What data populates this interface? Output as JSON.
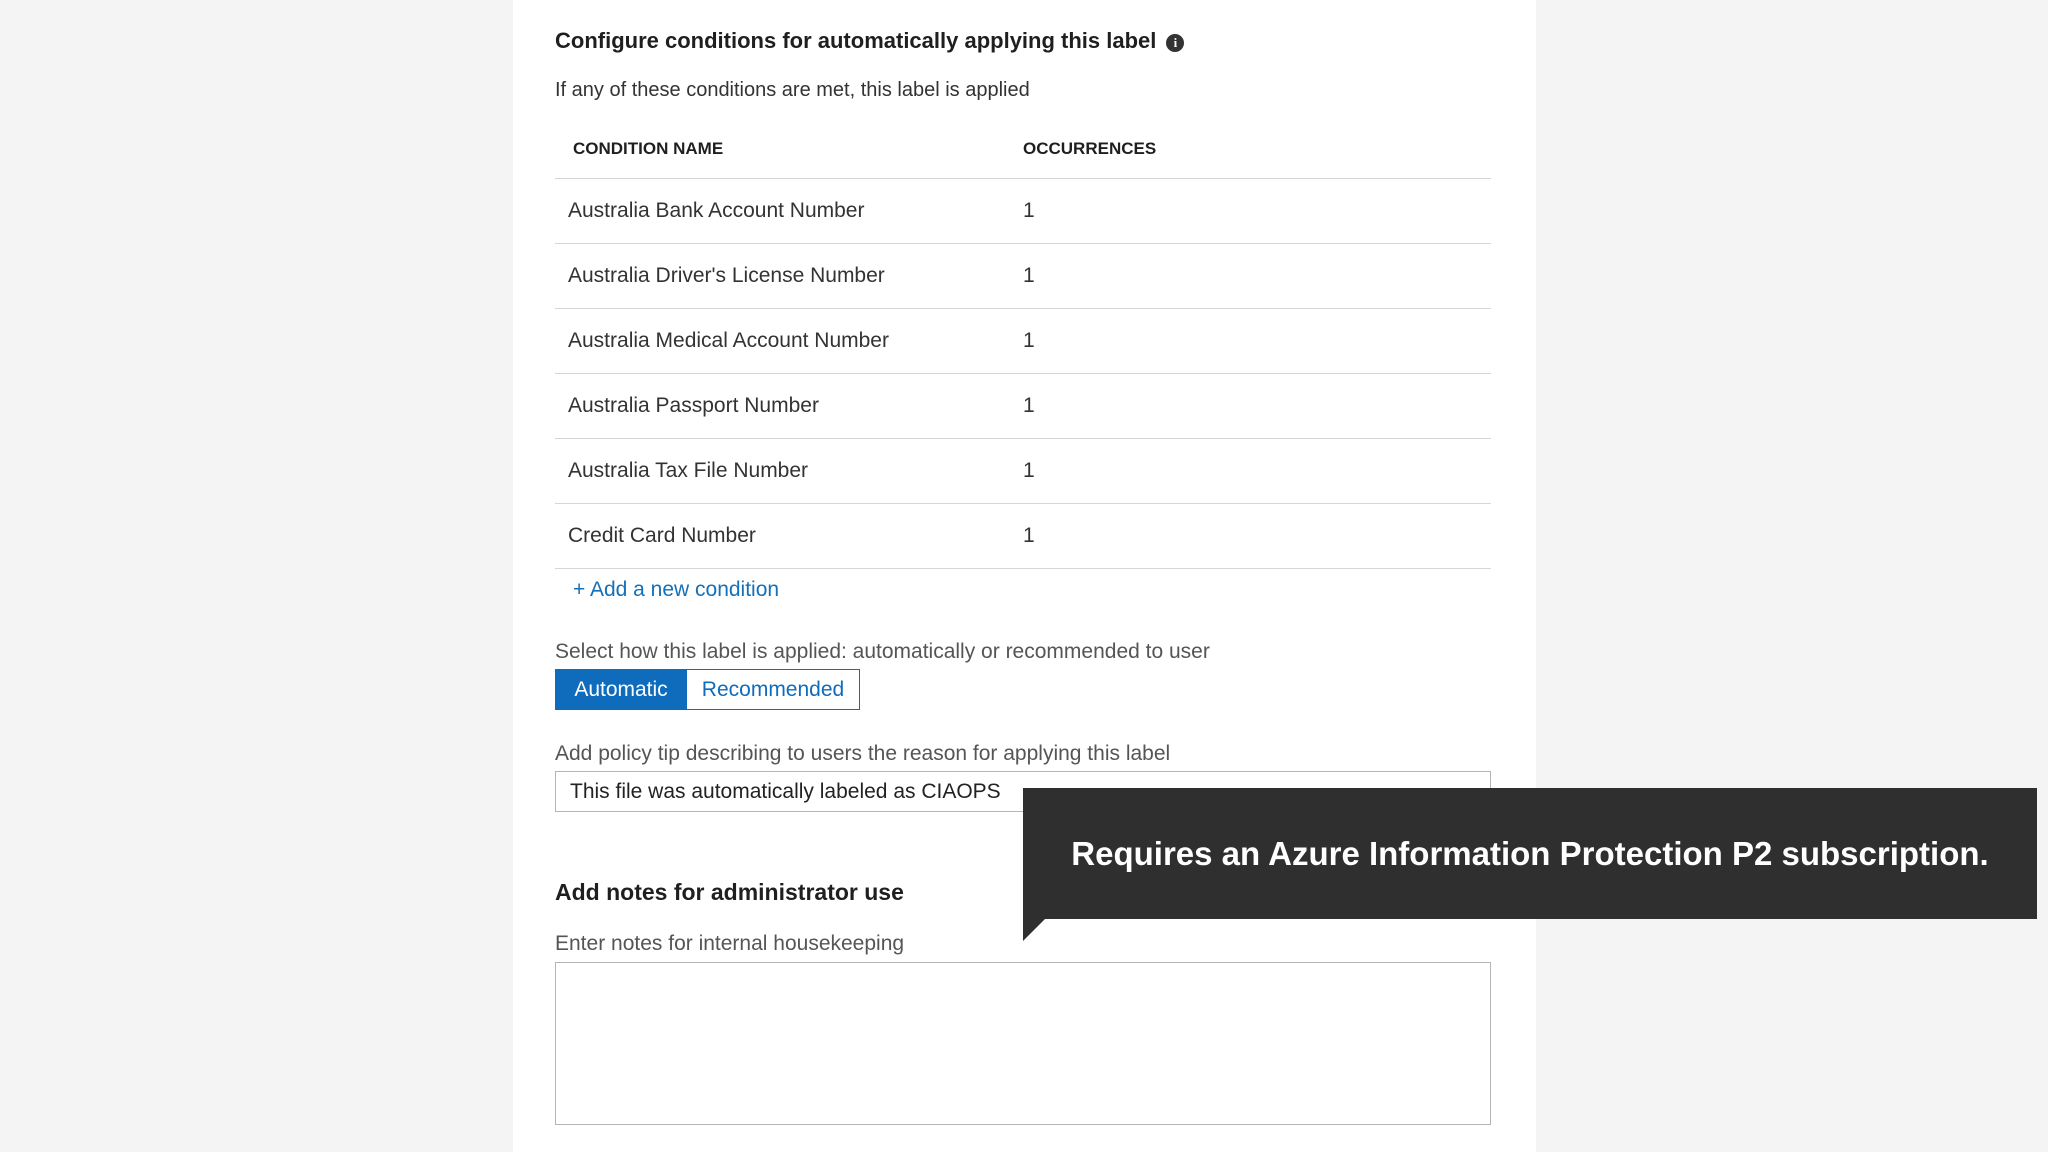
{
  "section": {
    "title": "Configure conditions for automatically applying this label",
    "info_icon": "i",
    "description": "If any of these conditions are met, this label is applied"
  },
  "table": {
    "headers": {
      "condition_name": "CONDITION NAME",
      "occurrences": "OCCURRENCES"
    },
    "rows": [
      {
        "name": "Australia Bank Account Number",
        "occurrences": "1"
      },
      {
        "name": "Australia Driver's License Number",
        "occurrences": "1"
      },
      {
        "name": "Australia Medical Account Number",
        "occurrences": "1"
      },
      {
        "name": "Australia Passport Number",
        "occurrences": "1"
      },
      {
        "name": "Australia Tax File Number",
        "occurrences": "1"
      },
      {
        "name": "Credit Card Number",
        "occurrences": "1"
      }
    ]
  },
  "add_condition": "+ Add a new condition",
  "apply_mode": {
    "label": "Select how this label is applied: automatically or recommended to user",
    "options": [
      "Automatic",
      "Recommended"
    ],
    "selected": "Automatic"
  },
  "policy_tip": {
    "label": "Add policy tip describing to users the reason for applying this label",
    "value": "This file was automatically labeled as CIAOPS"
  },
  "notes": {
    "heading": "Add notes for administrator use",
    "label": "Enter notes for internal housekeeping",
    "value": ""
  },
  "callout": {
    "text": "Requires an Azure Information Protection P2 subscription."
  },
  "colors": {
    "accent": "#0f6cbd",
    "link": "#1470b8",
    "callout_bg": "#2f2f2f"
  }
}
